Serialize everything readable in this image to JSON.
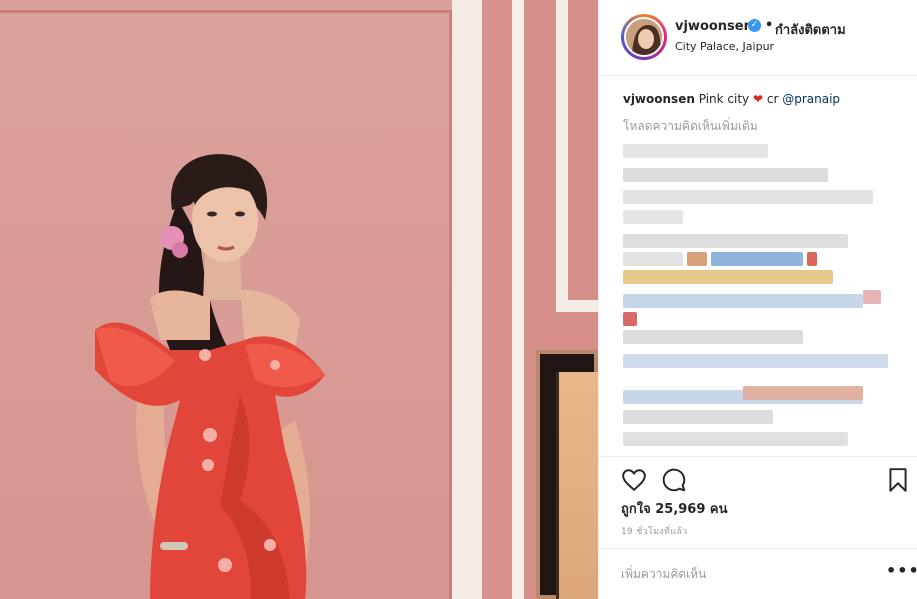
{
  "post": {
    "image_alt": "Woman in red ruffled dress in front of pink wall",
    "username": "vjwoonsen",
    "follow_status": "กำลังติดตาม",
    "location": "City Palace, Jaipur",
    "caption_text": "Pink city",
    "caption_credit": "cr",
    "caption_mention": "@pranaip",
    "load_more_comments": "โหลดความคิดเห็นเพิ่มเติม",
    "likes": "ถูกใจ 25,969 คน",
    "time_ago": "19 ชั่วโมงที่แล้ว",
    "comment_placeholder": "เพิ่มความคิดเห็น",
    "more_options": "•••"
  },
  "icons": {
    "verified": "verified-badge-icon",
    "like": "heart-icon",
    "comment": "comment-icon",
    "save": "bookmark-icon",
    "caption_emoji": "red-heart-emoji"
  },
  "colors": {
    "verified": "#3897f0",
    "text": "#262626",
    "muted": "#999999",
    "border": "#efefef"
  }
}
